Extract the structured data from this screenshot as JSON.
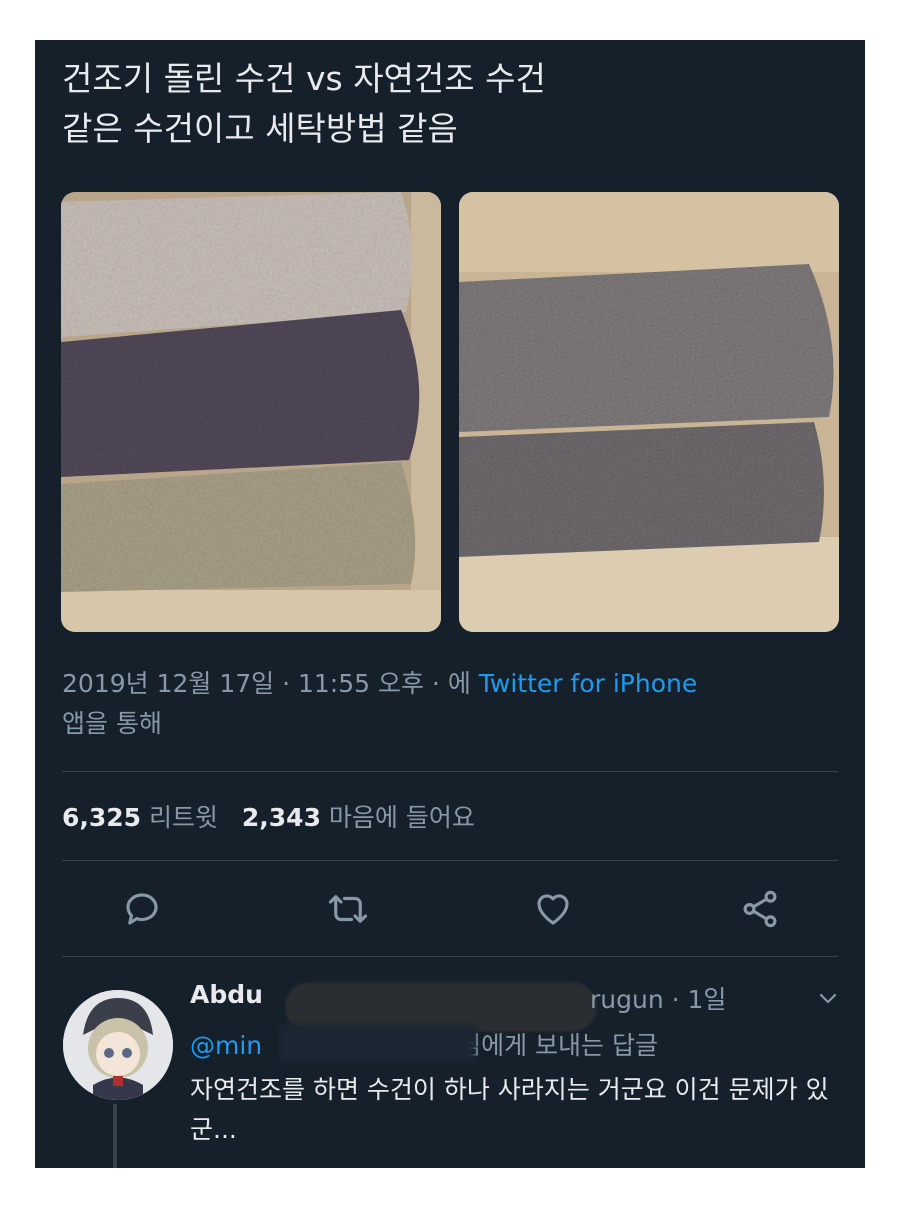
{
  "tweet": {
    "text_line1": "건조기 돌린 수건 vs 자연건조 수건",
    "text_line2": "같은 수건이고 세탁방법 같음",
    "timestamp": "2019년 12월 17일 · 11:55 오후 · 에",
    "app_name": "Twitter for iPhone",
    "via_text": "앱을 통해",
    "retweet_count": "6,325",
    "retweet_label": "리트윗",
    "like_count": "2,343",
    "like_label": "마음에 들어요"
  },
  "actions": {
    "icons": [
      "reply-icon",
      "retweet-icon",
      "like-icon",
      "share-icon"
    ]
  },
  "reply": {
    "name_visible": "Abdu",
    "handle_visible": "rugun · 1일",
    "mention_visible": "@min",
    "reply_to_suffix": "님에게 보내는 답글",
    "text": "자연건조를 하면 수건이 하나 사라지는 거군요 이건 문제가 있군..."
  },
  "colors": {
    "background": "#15202b",
    "text_primary": "#e8eaed",
    "text_secondary": "#8899a6",
    "link": "#1d9bf0",
    "divider": "#38444d"
  }
}
